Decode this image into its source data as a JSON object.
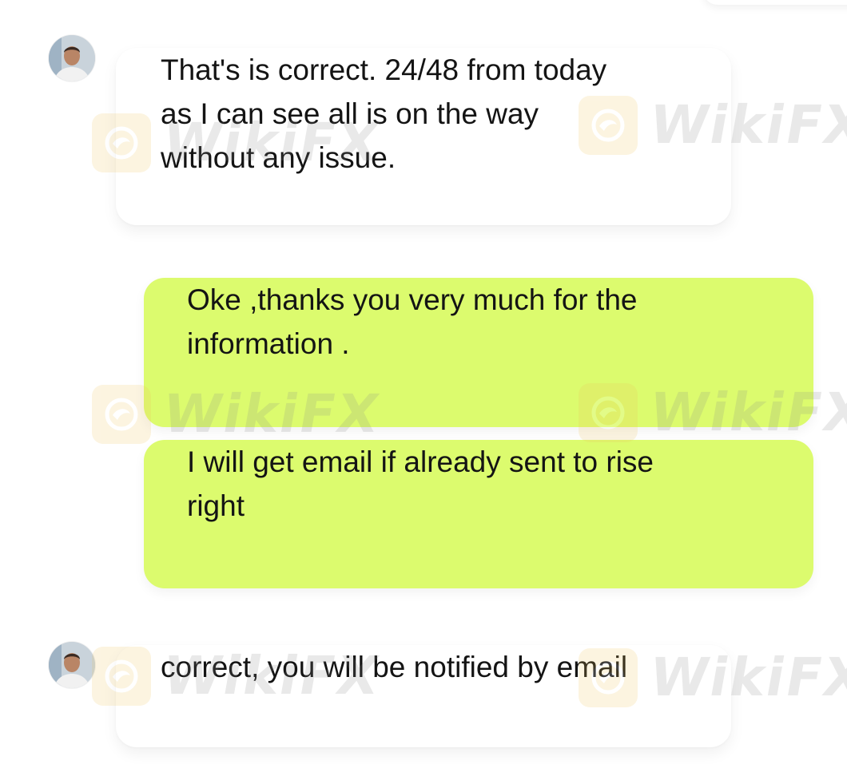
{
  "conversation": {
    "messages": [
      {
        "sender": "agent",
        "text": "That's is correct. 24/48 from today\nas I can see all is on the way\nwithout any issue."
      },
      {
        "sender": "user",
        "text": "Oke ,thanks you very much for the\ninformation ."
      },
      {
        "sender": "user",
        "text": "I will get email if already sent to rise\nright"
      },
      {
        "sender": "agent",
        "text": "correct, you will be notified by email"
      }
    ]
  },
  "watermark": {
    "text": "WikiFX",
    "icon": "wikifx-logo-icon"
  },
  "colors": {
    "outgoing_bubble": "#dcfb6e",
    "incoming_bubble": "#ffffff",
    "text": "#141414",
    "watermark_logo": "#f0c45a"
  }
}
